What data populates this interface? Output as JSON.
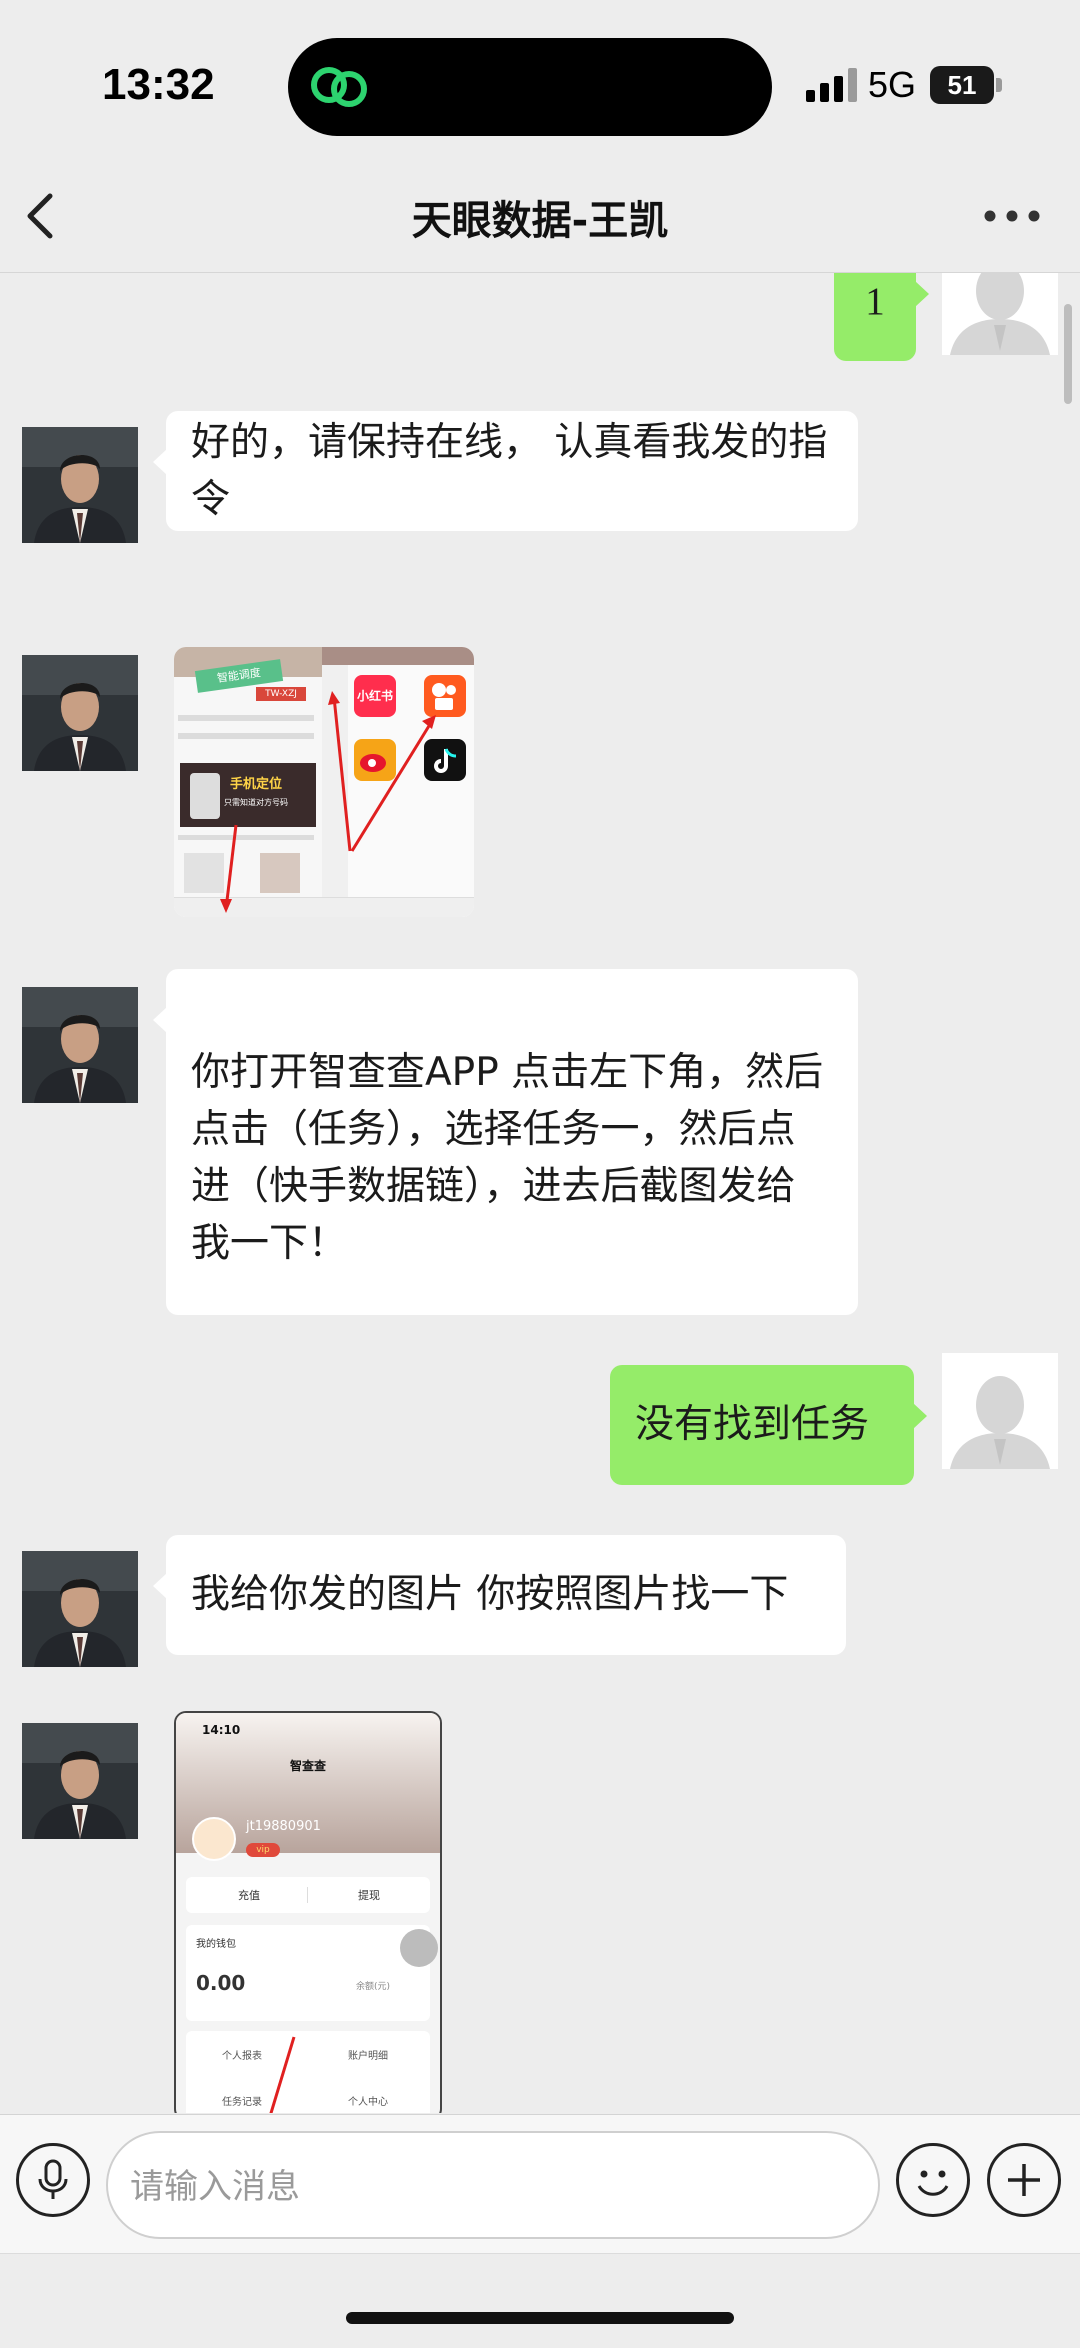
{
  "status_bar": {
    "time": "13:32",
    "network": "5G",
    "battery": "51"
  },
  "header": {
    "title": "天眼数据-王凯"
  },
  "messages": [
    {
      "from": "self",
      "type": "text",
      "text": "1"
    },
    {
      "from": "contact",
      "type": "text",
      "text": "好的，请保持在线， 认真看我发的指令"
    },
    {
      "from": "contact",
      "type": "image",
      "labels": {
        "banner": "智能调度",
        "badge": "TW-XZJ",
        "app_xhs": "小红书",
        "app_a": "小红书",
        "app_b": "快手",
        "app_c": "抖音",
        "locate": "手机定位",
        "locate_sub": "只需知道对方号码"
      }
    },
    {
      "from": "contact",
      "type": "text",
      "text": "你打开智查查APP 点击左下角，然后点击（任务），选择任务一，然后点进（快手数据链），进去后截图发给我一下！"
    },
    {
      "from": "self",
      "type": "text",
      "text": "没有找到任务"
    },
    {
      "from": "contact",
      "type": "text",
      "text": "我给你发的图片 你按照图片找一下"
    },
    {
      "from": "contact",
      "type": "image",
      "labels": {
        "time": "14:10",
        "app_title": "智查查",
        "username": "jt19880901",
        "vip": "vip",
        "recharge": "充值",
        "withdraw": "提现",
        "wallet": "我的钱包",
        "balance": "0.00",
        "balance_unit": "余额(元)",
        "report": "个人报表",
        "details": "账户明细",
        "tasks": "任务记录",
        "center": "个人中心"
      }
    }
  ],
  "input": {
    "placeholder": "请输入消息"
  },
  "colors": {
    "background": "#ededed",
    "self_bubble": "#95ec69",
    "contact_bubble": "#ffffff",
    "accent_green": "#07c160"
  },
  "icons": [
    "island-app-icon",
    "back-chevron-icon",
    "more-dots-icon",
    "contact-avatar",
    "default-user-avatar",
    "microphone-icon",
    "emoji-icon",
    "plus-icon"
  ]
}
